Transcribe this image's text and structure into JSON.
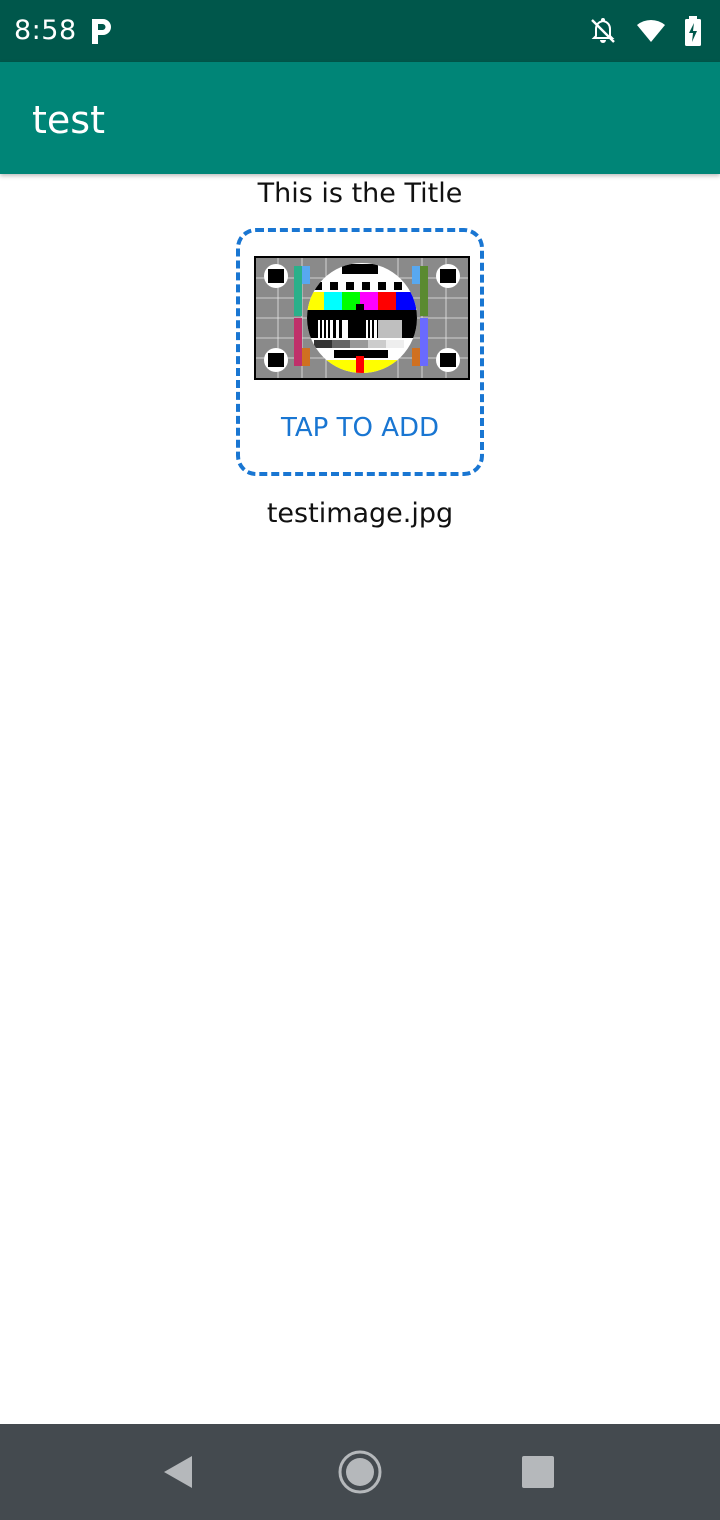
{
  "status_bar": {
    "time": "8:58",
    "icons": [
      "parking-icon",
      "notifications-off-icon",
      "wifi-icon",
      "battery-charging-icon"
    ]
  },
  "app_bar": {
    "title": "test"
  },
  "content": {
    "title": "This is the Title",
    "drop_zone": {
      "label": "TAP TO ADD",
      "image_icon": "test-pattern-image"
    },
    "filename": "testimage.jpg"
  },
  "nav_bar": {
    "buttons": [
      "back-icon",
      "home-icon",
      "recents-icon"
    ]
  },
  "colors": {
    "status_bar": "#00574b",
    "app_bar": "#008577",
    "accent": "#1976d2",
    "nav_bar": "#444a4f"
  }
}
